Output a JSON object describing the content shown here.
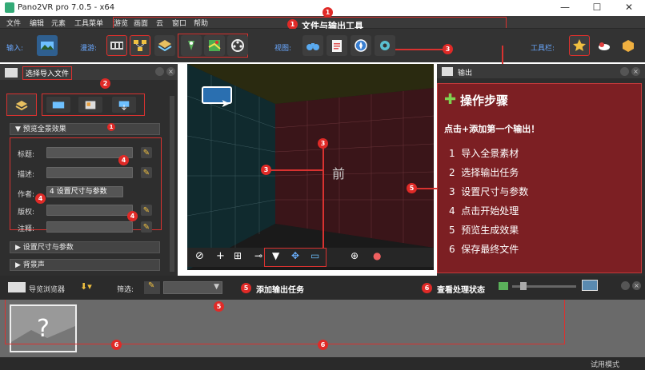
{
  "app": {
    "title": "Pano2VR pro 7.0.5 - x64"
  },
  "window_controls": {
    "minimize": "—",
    "maximize": "☐",
    "close": "✕"
  },
  "menu": [
    "文件",
    "编辑",
    "元素",
    "工具菜单",
    "游览",
    "画面",
    "云",
    "窗口",
    "帮助"
  ],
  "toolbar": {
    "input_label": "输入:",
    "tour_label": "漫游:",
    "view_label": "视图:",
    "toolbar_label": "工具栏:"
  },
  "left_panel": {
    "title": "选择导入文件",
    "section_preview": "预览全景效果",
    "fields": [
      {
        "label": "标题:",
        "value": ""
      },
      {
        "label": "描述:",
        "value": ""
      },
      {
        "label": "作者:",
        "value": "4  设置尺寸与参数"
      },
      {
        "label": "版权:",
        "value": ""
      },
      {
        "label": "注释:",
        "value": ""
      }
    ],
    "section_size": "设置尺寸与参数",
    "section_bg": "背景声"
  },
  "viewer": {
    "front_label": "前"
  },
  "output_panel": {
    "title": "输出",
    "steps_title": "操作步骤",
    "add_hint": "点击+添加第一个输出！",
    "steps": [
      {
        "num": "1",
        "text": "导入全景素材"
      },
      {
        "num": "2",
        "text": "选择输出任务"
      },
      {
        "num": "3",
        "text": "设置尺寸与参数"
      },
      {
        "num": "4",
        "text": "点击开始处理"
      },
      {
        "num": "5",
        "text": "预览生成效果"
      },
      {
        "num": "6",
        "text": "保存最终文件"
      }
    ]
  },
  "bottom_bar": {
    "browser_label": "导览浏览器",
    "filter_label": "筛选:",
    "add_output_task": "添加输出任务",
    "view_status": "查看处理状态"
  },
  "status": {
    "mode": "试用模式"
  },
  "annotations": {
    "title_banner": "文件与输出工具",
    "badges": [
      "1",
      "2",
      "3",
      "4",
      "5",
      "6"
    ]
  },
  "colors": {
    "annotation_red": "#e02a27",
    "panel_bg": "#2e2e2e",
    "accent_blue": "#6aa8ff"
  }
}
